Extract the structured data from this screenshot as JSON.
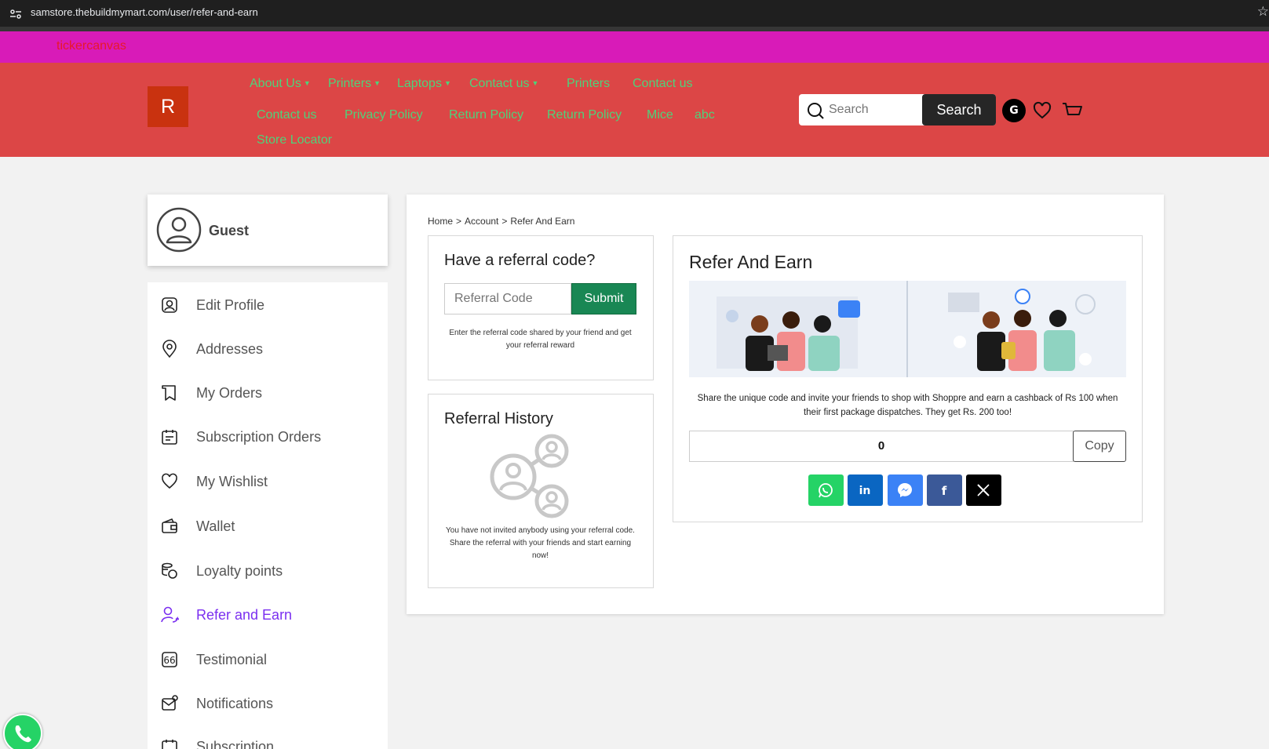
{
  "browser": {
    "url": "samstore.thebuildmymart.com/user/refer-and-earn"
  },
  "ticker": {
    "text": "tickercanvas"
  },
  "header": {
    "logo_letter": "R",
    "nav_row1": [
      {
        "label": "About Us",
        "dropdown": true
      },
      {
        "label": "Printers",
        "dropdown": true
      },
      {
        "label": "Laptops",
        "dropdown": true
      },
      {
        "label": "Contact us",
        "dropdown": true
      },
      {
        "label": "Printers",
        "dropdown": false
      },
      {
        "label": "Contact us",
        "dropdown": false
      }
    ],
    "nav_row2": [
      "Contact us",
      "Privacy Policy",
      "Return Policy",
      "Return Policy",
      "Mice",
      "abc"
    ],
    "nav_row3": [
      "Store Locator"
    ],
    "search_placeholder": "Search",
    "search_button": "Search",
    "user_initial": "G",
    "colors": {
      "header_bg": "#dc4646",
      "nav_text": "#4fd27a",
      "ticker_bg": "#d81bb8"
    }
  },
  "sidebar": {
    "user_name": "Guest",
    "items": [
      {
        "label": "Edit Profile",
        "icon": "user-square-icon"
      },
      {
        "label": "Addresses",
        "icon": "location-pin-icon"
      },
      {
        "label": "My Orders",
        "icon": "receipt-icon"
      },
      {
        "label": "Subscription Orders",
        "icon": "calendar-icon"
      },
      {
        "label": "My Wishlist",
        "icon": "heart-icon"
      },
      {
        "label": "Wallet",
        "icon": "wallet-icon"
      },
      {
        "label": "Loyalty points",
        "icon": "coins-icon"
      },
      {
        "label": "Refer and Earn",
        "icon": "refer-user-icon",
        "active": true
      },
      {
        "label": "Testimonial",
        "icon": "quote-icon"
      },
      {
        "label": "Notifications",
        "icon": "bell-mail-icon"
      },
      {
        "label": "Subscription",
        "icon": "calendar-icon"
      }
    ],
    "active_color": "#7b2ff0"
  },
  "main": {
    "breadcrumb": [
      "Home",
      "Account",
      "Refer And Earn"
    ],
    "referral_code": {
      "title": "Have a referral code?",
      "placeholder": "Referral Code",
      "submit": "Submit",
      "help": "Enter the referral code shared by your friend and get your referral reward"
    },
    "history": {
      "title": "Referral History",
      "empty_text": "You have not invited anybody using your referral code. Share the referral with your friends and start earning now!"
    },
    "refer": {
      "title": "Refer And Earn",
      "description": "Share the unique code and invite your friends to shop with Shoppre and earn a cashback of Rs 100 when their first package dispatches. They get Rs. 200 too!",
      "code_value": "0",
      "copy": "Copy",
      "share": [
        {
          "name": "whatsapp",
          "color": "#25d366",
          "icon": "whatsapp-icon"
        },
        {
          "name": "linkedin",
          "color": "#0a66c2",
          "icon": "linkedin-icon"
        },
        {
          "name": "messenger",
          "color": "#3b82f6",
          "icon": "messenger-icon"
        },
        {
          "name": "facebook",
          "color": "#3b5998",
          "icon": "facebook-icon"
        },
        {
          "name": "x",
          "color": "#000000",
          "icon": "x-icon"
        }
      ]
    }
  }
}
